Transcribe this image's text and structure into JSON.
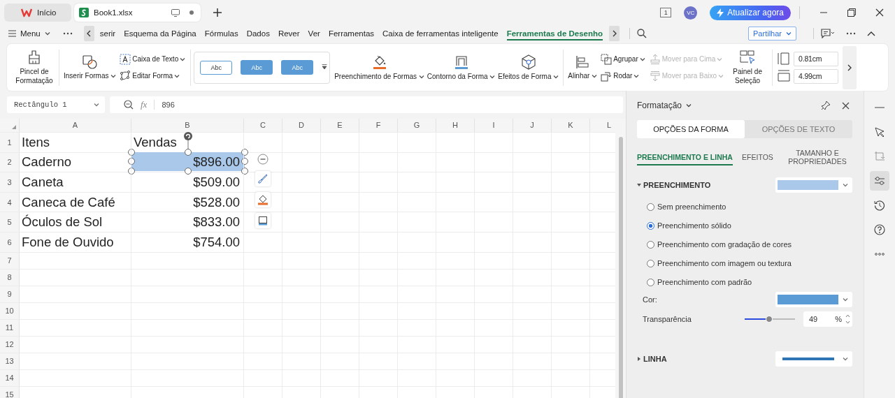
{
  "tabs": [
    {
      "label": "Início",
      "kind": "home",
      "selected": false
    },
    {
      "label": "Book1.xlsx",
      "kind": "sheet",
      "selected": true
    }
  ],
  "title_bar": {
    "window_count": "1",
    "avatar": "VC",
    "upgrade_button": "Atualizar agora"
  },
  "menu": {
    "label": "Menu",
    "items": [
      {
        "label": "serir",
        "selected": false
      },
      {
        "label": "Esquema da Página",
        "selected": false
      },
      {
        "label": "Fórmulas",
        "selected": false
      },
      {
        "label": "Dados",
        "selected": false
      },
      {
        "label": "Rever",
        "selected": false
      },
      {
        "label": "Ver",
        "selected": false
      },
      {
        "label": "Ferramentas",
        "selected": false
      },
      {
        "label": "Caixa de ferramentas inteligente",
        "selected": false
      },
      {
        "label": "Ferramentas de Desenho",
        "selected": true
      }
    ],
    "share_button": "Partilhar"
  },
  "ribbon": {
    "format_painter": "Pincel de Formatação",
    "insert_shapes": "Inserir Formas",
    "text_box": "Caixa de Texto",
    "edit_shape": "Editar Forma",
    "styles": [
      {
        "label": "Abc",
        "kind": "outline"
      },
      {
        "label": "Abc",
        "kind": "filled"
      },
      {
        "label": "Abc",
        "kind": "filled"
      }
    ],
    "shape_fill": "Preenchimento de Formas",
    "shape_outline": "Contorno da Forma",
    "shape_effects": "Efeitos de Forma",
    "align": "Alinhar",
    "group": {
      "label": "Agrupar",
      "disabled": false
    },
    "rotate": {
      "label": "Rodar",
      "disabled": false
    },
    "bring_forward": {
      "label": "Mover para Cima",
      "disabled": true
    },
    "send_backward": {
      "label": "Mover para Baixo",
      "disabled": true
    },
    "selection_pane": "Painel de Seleção",
    "height": "0.81cm",
    "width": "4.99cm"
  },
  "formula_bar": {
    "name_box": "Rectângulo 1",
    "function_label": "fx",
    "value": "896"
  },
  "sheet": {
    "columns": [
      "A",
      "B",
      "C",
      "D",
      "E",
      "F",
      "G",
      "H",
      "I",
      "J",
      "K",
      "L"
    ],
    "rows": [
      {
        "number": "1",
        "cells": [
          {
            "text": "Itens",
            "kind": "text"
          },
          {
            "text": "Vendas",
            "kind": "text"
          }
        ]
      },
      {
        "number": "2",
        "cells": [
          {
            "text": "Caderno",
            "kind": "text"
          },
          {
            "text": "$896.00",
            "kind": "number"
          }
        ]
      },
      {
        "number": "3",
        "cells": [
          {
            "text": "Caneta",
            "kind": "text"
          },
          {
            "text": "$509.00",
            "kind": "number"
          }
        ]
      },
      {
        "number": "4",
        "cells": [
          {
            "text": "Caneca de Café",
            "kind": "text"
          },
          {
            "text": "$528.00",
            "kind": "number"
          }
        ]
      },
      {
        "number": "5",
        "cells": [
          {
            "text": "Óculos de Sol",
            "kind": "text"
          },
          {
            "text": "$833.00",
            "kind": "number"
          }
        ]
      },
      {
        "number": "6",
        "cells": [
          {
            "text": "Fone de Ouvido",
            "kind": "text"
          },
          {
            "text": "$754.00",
            "kind": "number"
          }
        ]
      },
      {
        "number": "7"
      },
      {
        "number": "8"
      },
      {
        "number": "9"
      },
      {
        "number": "10"
      },
      {
        "number": "11"
      },
      {
        "number": "12"
      },
      {
        "number": "13"
      },
      {
        "number": "14"
      },
      {
        "number": "15"
      }
    ],
    "shape_tools": [
      {
        "kind": "remove"
      },
      {
        "kind": "brush"
      },
      {
        "kind": "fill"
      },
      {
        "kind": "outline"
      }
    ]
  },
  "panel": {
    "title": "Formatação",
    "tabs": [
      {
        "label": "OPÇÕES DA FORMA",
        "selected": true
      },
      {
        "label": "OPÇÕES DE TEXTO",
        "selected": false
      }
    ],
    "subtabs": [
      {
        "label": "PREENCHIMENTO E LINHA",
        "selected": true
      },
      {
        "label": "EFEITOS",
        "selected": false
      },
      {
        "label": "TAMANHO E PROPRIEDADES",
        "selected": false
      }
    ],
    "fill": {
      "label": "PREENCHIMENTO",
      "expanded": true,
      "color": "#a9c8ea",
      "options": [
        {
          "label": "Sem preenchimento",
          "selected": false
        },
        {
          "label": "Preenchimento sólido",
          "selected": true
        },
        {
          "label": "Preenchimento com gradação de cores",
          "selected": false
        },
        {
          "label": "Preenchimento com imagem ou textura",
          "selected": false
        },
        {
          "label": "Preenchimento com padrão",
          "selected": false
        }
      ],
      "color_field": {
        "label": "Cor:",
        "color": "#5b9bd5"
      },
      "transparency_label": "Transparência",
      "level": 0.49,
      "transparency_value": "49",
      "unit": "%"
    },
    "line": {
      "label": "LINHA",
      "expanded": false,
      "color": "#2e75b6"
    }
  },
  "side_tools": [
    {
      "kind": "collapse",
      "selected": false
    },
    {
      "kind": "select",
      "selected": false
    },
    {
      "kind": "crop",
      "selected": false
    },
    {
      "kind": "properties",
      "selected": true
    },
    {
      "kind": "history",
      "selected": false
    },
    {
      "kind": "help",
      "selected": false
    },
    {
      "kind": "more",
      "selected": false
    }
  ]
}
